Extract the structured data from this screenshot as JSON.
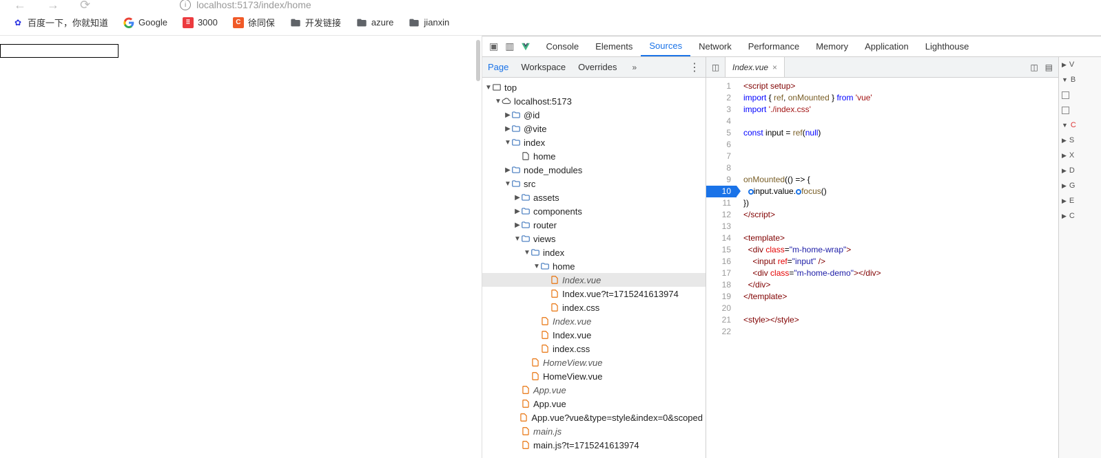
{
  "browser": {
    "url": "localhost:5173/index/home",
    "bookmarks": [
      {
        "icon": "baidu",
        "label": "百度一下，你就知道"
      },
      {
        "icon": "google",
        "label": "Google"
      },
      {
        "icon": "red",
        "badge": "",
        "label": "3000"
      },
      {
        "icon": "orange",
        "badge": "C",
        "label": "徐同保"
      },
      {
        "icon": "folder",
        "label": "开发链接"
      },
      {
        "icon": "folder",
        "label": "azure"
      },
      {
        "icon": "folder",
        "label": "jianxin"
      }
    ]
  },
  "devtools": {
    "tabs": [
      "Console",
      "Elements",
      "Sources",
      "Network",
      "Performance",
      "Memory",
      "Application",
      "Lighthouse"
    ],
    "active_tab": "Sources",
    "sub_tabs": [
      "Page",
      "Workspace",
      "Overrides"
    ],
    "active_sub": "Page"
  },
  "tree": [
    {
      "d": 0,
      "t": "tri-down",
      "ic": "frame",
      "lbl": "top"
    },
    {
      "d": 1,
      "t": "tri-down",
      "ic": "cloud",
      "lbl": "localhost:5173"
    },
    {
      "d": 2,
      "t": "tri-right",
      "ic": "folder",
      "lbl": "@id"
    },
    {
      "d": 2,
      "t": "tri-right",
      "ic": "folder",
      "lbl": "@vite"
    },
    {
      "d": 2,
      "t": "tri-down",
      "ic": "folder",
      "lbl": "index"
    },
    {
      "d": 3,
      "t": "",
      "ic": "file",
      "lbl": "home"
    },
    {
      "d": 2,
      "t": "tri-right",
      "ic": "folder",
      "lbl": "node_modules"
    },
    {
      "d": 2,
      "t": "tri-down",
      "ic": "folder",
      "lbl": "src"
    },
    {
      "d": 3,
      "t": "tri-right",
      "ic": "folder",
      "lbl": "assets"
    },
    {
      "d": 3,
      "t": "tri-right",
      "ic": "folder",
      "lbl": "components"
    },
    {
      "d": 3,
      "t": "tri-right",
      "ic": "folder",
      "lbl": "router"
    },
    {
      "d": 3,
      "t": "tri-down",
      "ic": "folder",
      "lbl": "views"
    },
    {
      "d": 4,
      "t": "tri-down",
      "ic": "folder",
      "lbl": "index"
    },
    {
      "d": 5,
      "t": "tri-down",
      "ic": "folder",
      "lbl": "home"
    },
    {
      "d": 6,
      "t": "",
      "ic": "ofile",
      "lbl": "Index.vue",
      "sel": true,
      "italic": true
    },
    {
      "d": 6,
      "t": "",
      "ic": "ofile",
      "lbl": "Index.vue?t=1715241613974"
    },
    {
      "d": 6,
      "t": "",
      "ic": "ofile",
      "lbl": "index.css"
    },
    {
      "d": 5,
      "t": "",
      "ic": "ofile",
      "lbl": "Index.vue",
      "italic": true
    },
    {
      "d": 5,
      "t": "",
      "ic": "ofile",
      "lbl": "Index.vue"
    },
    {
      "d": 5,
      "t": "",
      "ic": "ofile",
      "lbl": "index.css"
    },
    {
      "d": 4,
      "t": "",
      "ic": "ofile",
      "lbl": "HomeView.vue",
      "italic": true
    },
    {
      "d": 4,
      "t": "",
      "ic": "ofile",
      "lbl": "HomeView.vue"
    },
    {
      "d": 3,
      "t": "",
      "ic": "ofile",
      "lbl": "App.vue",
      "italic": true
    },
    {
      "d": 3,
      "t": "",
      "ic": "ofile",
      "lbl": "App.vue"
    },
    {
      "d": 3,
      "t": "",
      "ic": "ofile",
      "lbl": "App.vue?vue&type=style&index=0&scoped"
    },
    {
      "d": 3,
      "t": "",
      "ic": "ofile",
      "lbl": "main.js",
      "italic": true
    },
    {
      "d": 3,
      "t": "",
      "ic": "ofile",
      "lbl": "main.js?t=1715241613974"
    }
  ],
  "editor": {
    "tab_name": "Index.vue",
    "highlight_line": 10,
    "lines": [
      {
        "n": 1,
        "h": "<span class='tag'>&lt;script setup&gt;</span>"
      },
      {
        "n": 2,
        "h": "<span class='blue'>import</span> { <span class='fn'>ref</span>, <span class='fn'>onMounted</span> } <span class='blue'>from</span> <span class='str'>'vue'</span>"
      },
      {
        "n": 3,
        "h": "<span class='blue'>import</span> <span class='str'>'./index.css'</span>"
      },
      {
        "n": 4,
        "h": ""
      },
      {
        "n": 5,
        "h": "<span class='blue'>const</span> input = <span class='fn'>ref</span>(<span class='blue'>null</span>)"
      },
      {
        "n": 6,
        "h": ""
      },
      {
        "n": 7,
        "h": ""
      },
      {
        "n": 8,
        "h": ""
      },
      {
        "n": 9,
        "h": "<span class='fn'>onMounted</span>(() =&gt; {"
      },
      {
        "n": 10,
        "h": "  <span class='dot'></span>input.value.<span class='dot'></span><span class='fn'>focus</span>()"
      },
      {
        "n": 11,
        "h": "})"
      },
      {
        "n": 12,
        "h": "<span class='tag'>&lt;/script&gt;</span>"
      },
      {
        "n": 13,
        "h": ""
      },
      {
        "n": 14,
        "h": "<span class='tag'>&lt;template&gt;</span>"
      },
      {
        "n": 15,
        "h": "  <span class='tag'>&lt;div</span> <span class='attr'>class</span>=<span class='val'>\"m-home-wrap\"</span><span class='tag'>&gt;</span>"
      },
      {
        "n": 16,
        "h": "    <span class='tag'>&lt;input</span> <span class='attr'>ref</span>=<span class='val'>\"input\"</span> <span class='tag'>/&gt;</span>"
      },
      {
        "n": 17,
        "h": "    <span class='tag'>&lt;div</span> <span class='attr'>class</span>=<span class='val'>\"m-home-demo\"</span><span class='tag'>&gt;&lt;/div&gt;</span>"
      },
      {
        "n": 18,
        "h": "  <span class='tag'>&lt;/div&gt;</span>"
      },
      {
        "n": 19,
        "h": "<span class='tag'>&lt;/template&gt;</span>"
      },
      {
        "n": 20,
        "h": ""
      },
      {
        "n": 21,
        "h": "<span class='tag'>&lt;style&gt;&lt;/style&gt;</span>"
      },
      {
        "n": 22,
        "h": ""
      }
    ]
  },
  "rail": [
    "V",
    "B",
    "",
    "C",
    "S",
    "X",
    "D",
    "G",
    "E",
    "C"
  ]
}
